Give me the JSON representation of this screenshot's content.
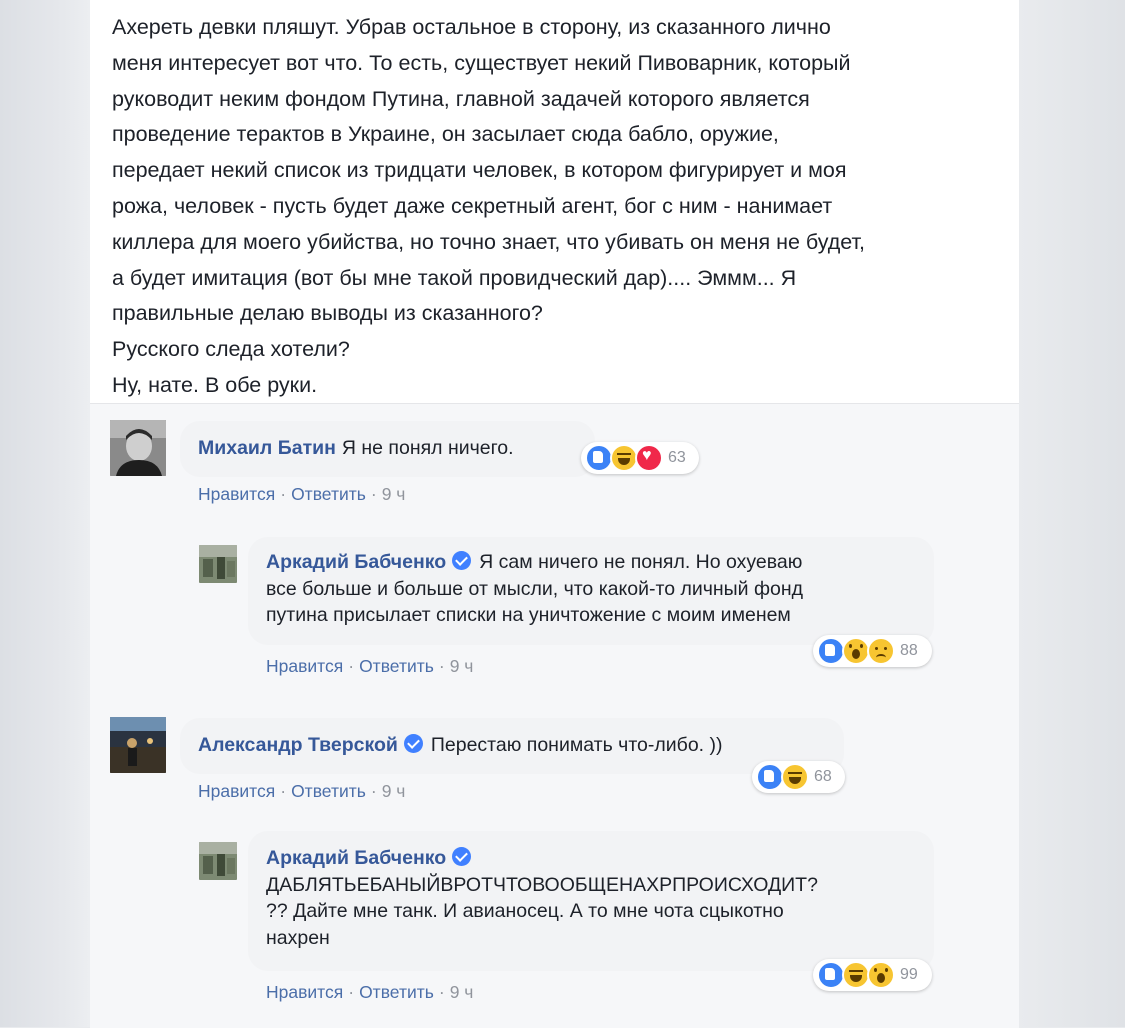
{
  "post": {
    "lines": [
      "Ахереть девки пляшут. Убрав остальное в сторону, из сказанного лично",
      "меня интересует вот что. То есть, существует некий Пивоварник, который",
      "руководит неким фондом Путина, главной задачей которого является",
      "проведение терактов в Украине, он засылает сюда бабло, оружие,",
      "передает некий список из тридцати человек, в котором фигурирует и моя",
      "рожа, человек - пусть будет даже секретный агент, бог с ним - нанимает",
      "киллера для моего убийства, но точно знает, что убивать он меня не будет,",
      "а будет имитация (вот бы мне такой провидческий дар).... Эммм... Я",
      "правильные делаю выводы из сказанного?",
      "Русского следа хотели?",
      "Ну, нате. В обе руки."
    ]
  },
  "labels": {
    "like": "Нравится",
    "reply": "Ответить",
    "sep": "·"
  },
  "comments": [
    {
      "author": "Михаил Батин",
      "text": "Я не понял ничего.",
      "time": "9 ч",
      "reactions": [
        "like",
        "haha",
        "love"
      ],
      "count": "63"
    },
    {
      "author": "Аркадий Бабченко",
      "lines": [
        "Я сам ничего не понял. Но охуеваю",
        "все больше и больше от мысли, что какой-то личный фонд",
        "путина присылает списки на уничтожение с моим именем"
      ],
      "time": "9 ч",
      "reactions": [
        "like",
        "wow",
        "sad"
      ],
      "count": "88"
    },
    {
      "author": "Александр Тверской",
      "text": "Перестаю понимать что-либо. ))",
      "time": "9 ч",
      "reactions": [
        "like",
        "haha"
      ],
      "count": "68"
    },
    {
      "author": "Аркадий Бабченко",
      "lines": [
        "ДАБЛЯТЬЕБАНЫЙВРОТЧТОВООБЩЕНАХРПРОИСХОДИТ?",
        "?? Дайте мне танк. И авианосец. А то мне чота сцыкотно",
        "нахрен"
      ],
      "time": "9 ч",
      "reactions": [
        "like",
        "haha",
        "wow"
      ],
      "count": "99"
    }
  ]
}
